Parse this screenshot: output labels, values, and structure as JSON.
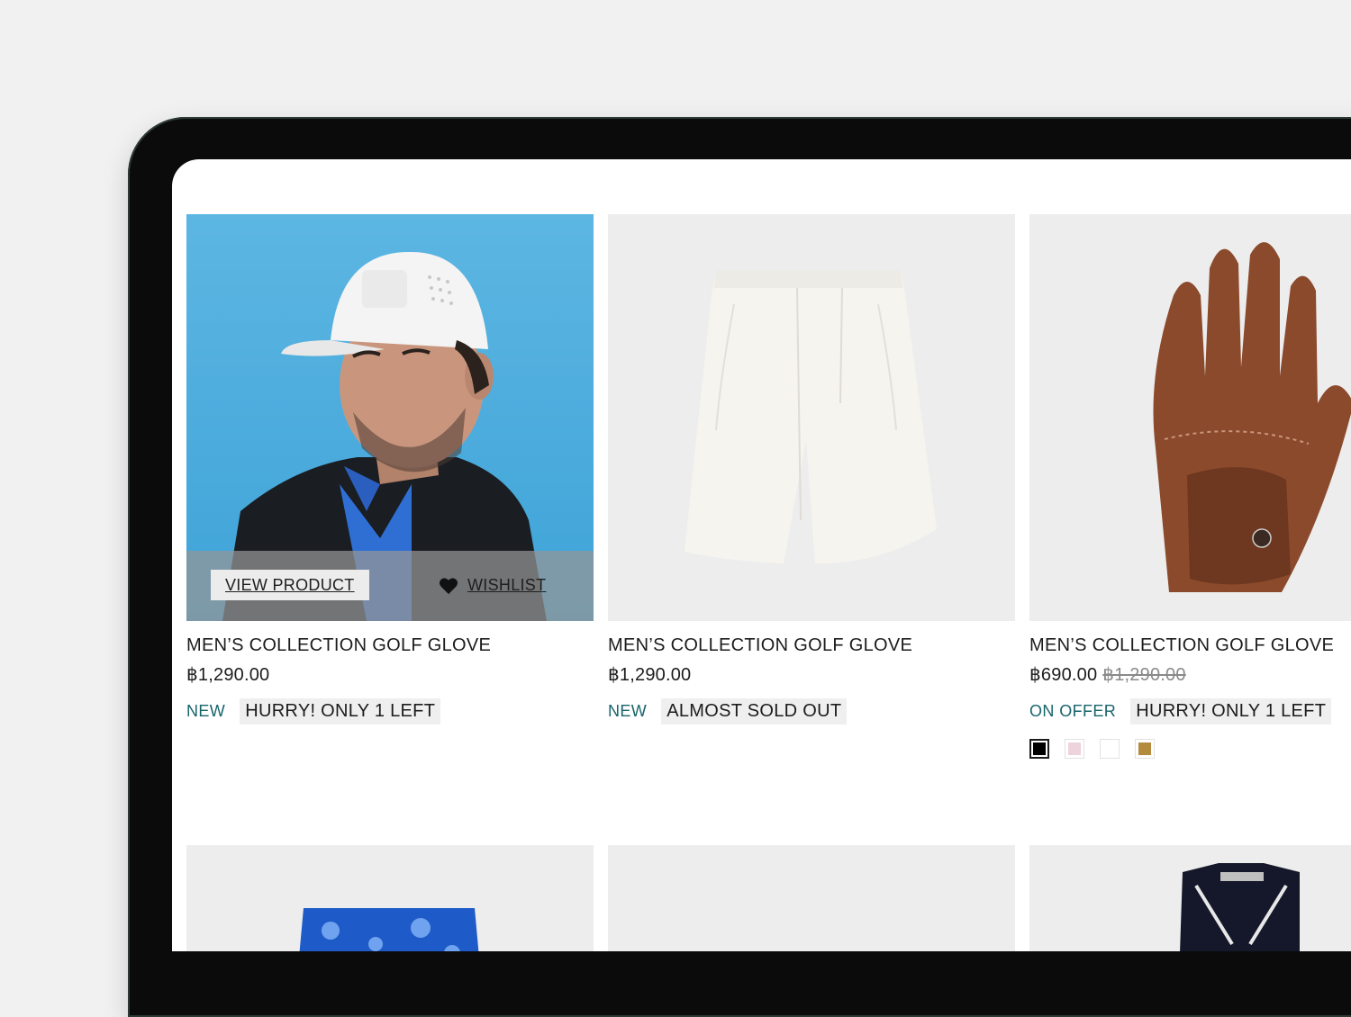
{
  "products": [
    {
      "title": "MEN’S COLLECTION GOLF GLOVE",
      "price": "฿1,290.00",
      "badge": "NEW",
      "stock": "HURRY! ONLY 1 LEFT",
      "view_label": "VIEW PRODUCT",
      "wishlist_label": "WISHLIST"
    },
    {
      "title": "MEN’S COLLECTION GOLF GLOVE",
      "price": "฿1,290.00",
      "badge": "NEW",
      "stock": "ALMOST SOLD OUT"
    },
    {
      "title": "MEN’S COLLECTION GOLF GLOVE",
      "price": "฿690.00",
      "old_price": "฿1,290.00",
      "badge": "ON OFFER",
      "stock": "HURRY! ONLY 1 LEFT",
      "swatches": [
        "#000000",
        "#ecd3dc",
        "#ffffff",
        "#b48a3c"
      ]
    }
  ],
  "colors": {
    "badge": "#17646b",
    "stock_bg": "#efefef",
    "image_bg": "#ededed",
    "hero_bg": "#4aaede"
  }
}
